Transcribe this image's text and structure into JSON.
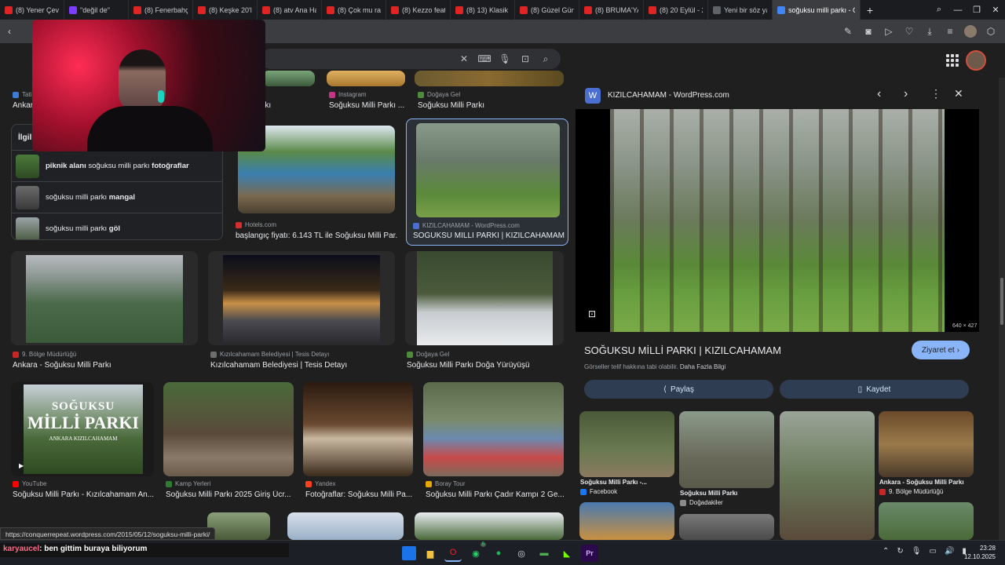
{
  "tabs": [
    {
      "label": "(8) Yener Çevik - I",
      "color": "#e02424"
    },
    {
      "label": "\"değil de\"",
      "color": "#7d3cff"
    },
    {
      "label": "(8) Fenerbahçe - A",
      "color": "#e02424"
    },
    {
      "label": "(8) Keşke 20'lerim",
      "color": "#e02424"
    },
    {
      "label": "(8) atv Ana Haber",
      "color": "#e02424"
    },
    {
      "label": "(8) Çok mu rahatı",
      "color": "#e02424"
    },
    {
      "label": "(8) Kezzo feat. Fre",
      "color": "#e02424"
    },
    {
      "label": "(8) 13) Klasik Koşı",
      "color": "#e02424"
    },
    {
      "label": "(8) Güzel Günleri",
      "color": "#e02424"
    },
    {
      "label": "(8) BRUMA'YA NE",
      "color": "#e02424"
    },
    {
      "label": "(8) 20 Eylül - 27 E",
      "color": "#e02424"
    },
    {
      "label": "Yeni bir söz yazma",
      "color": "#5f6368"
    },
    {
      "label": "soğuksu milli parkı - Goo",
      "color": "#4285f4"
    }
  ],
  "results": [
    {
      "source": "Tatil",
      "title": "Ankara",
      "icon_color": "#3c7bd6"
    },
    {
      "source": "",
      "title": "rkı",
      "icon_color": "#5f6368"
    },
    {
      "source": "Instagram",
      "title": "Soğuksu Milli Parkı ...",
      "icon_color": "#c13584"
    },
    {
      "source": "Doğaya Gel",
      "title": "Soğuksu Milli Parkı",
      "icon_color": "#4f8a3a"
    },
    {
      "source": "Hotels.com",
      "title": "başlangıç fiyatı: 6.143 TL ile Soğuksu Milli Par...",
      "icon_color": "#d32f2f"
    },
    {
      "source": "KIZILCAHAMAM - WordPress.com",
      "title": "SOĞUKSU MİLLİ PARKI | KIZILCAHAMAM",
      "icon_color": "#4a6fd1"
    },
    {
      "source": "9. Bölge Müdürlüğü",
      "title": "Ankara - Soğuksu Milli Parkı",
      "icon_color": "#c62828"
    },
    {
      "source": "Kızılcahamam Belediyesi | Tesis Detayı",
      "title": "Kızılcahamam Belediyesi | Tesis Detayı",
      "icon_color": "#6d6d6d"
    },
    {
      "source": "Doğaya Gel",
      "title": "Soğuksu Milli Parkı Doğa Yürüyüşü",
      "icon_color": "#4f8a3a"
    },
    {
      "source": "YouTube",
      "title": "Soğuksu Milli Parkı - Kızılcahamam An...",
      "icon_color": "#ff0000"
    },
    {
      "source": "Kamp Yerleri",
      "title": "Soğuksu Milli Parkı 2025 Giriş Ücr...",
      "icon_color": "#2e7d32"
    },
    {
      "source": "Yandex",
      "title": "Fotoğraflar: Soğuksu Milli Pa...",
      "icon_color": "#fc3f1d"
    },
    {
      "source": "Boray Tour",
      "title": "Soğuksu Milli Parkı Çadır Kampı 2 Ge...",
      "icon_color": "#e6a800"
    }
  ],
  "related": {
    "header": "İlgili",
    "items": [
      {
        "pre": "piknik alanı",
        "mid": " soğuksu milli parkı ",
        "post": "fotoğraflar"
      },
      {
        "pre": "",
        "mid": "soğuksu milli parkı ",
        "post": "mangal"
      },
      {
        "pre": "",
        "mid": "soğuksu milli parkı ",
        "post": "göl"
      }
    ]
  },
  "yt_thumb": {
    "line1": "SOĞUKSU",
    "line2": "MİLLİ PARKI",
    "line3": "ANKARA KIZILCAHAMAM"
  },
  "panel": {
    "site": "KIZILCAHAMAM - WordPress.com",
    "title": "SOĞUKSU MİLLİ PARKI | KIZILCAHAMAM",
    "visit_label": "Ziyaret et",
    "notice": "Görseller telif hakkına tabi olabilir.",
    "more_info": "Daha Fazla Bilgi",
    "share_label": "Paylaş",
    "save_label": "Kaydet",
    "dims": "640 × 427",
    "similar": [
      {
        "title": "Soğuksu Milli Parkı -...",
        "source": "Facebook",
        "icon_color": "#1877f2"
      },
      {
        "title": "Soğuksu Milli Parkı",
        "source": "Doğadakiler",
        "icon_color": "#8a8a8a"
      },
      {
        "title": "",
        "source": "",
        "icon_color": "#000000"
      },
      {
        "title": "Ankara - Soğuksu Milli Parkı",
        "source": "9. Bölge Müdürlüğü",
        "icon_color": "#c62828"
      }
    ]
  },
  "status_url": "https://conquerrepeat.wordpress.com/2015/05/12/soguksu-milli-parki/",
  "chat": {
    "user": "karyaucel",
    "message": ": ben gittim buraya biliyorum"
  },
  "clock": {
    "time": "23:28",
    "date": "12.10.2025"
  },
  "taskbar_badge": "5"
}
